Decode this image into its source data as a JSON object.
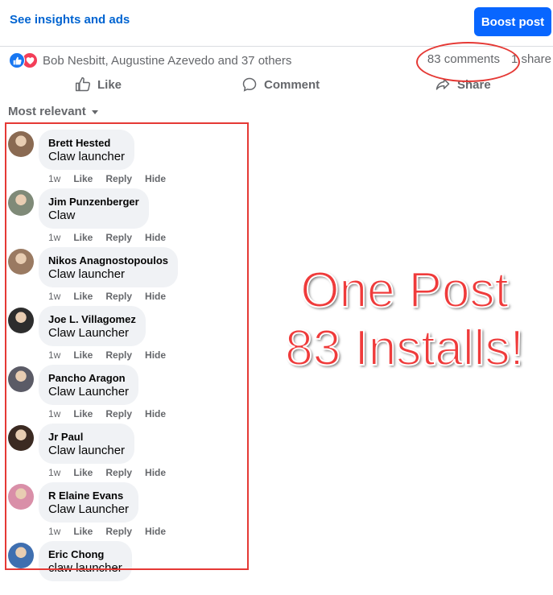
{
  "header": {
    "insights_link": "See insights and ads",
    "boost_button": "Boost post"
  },
  "reactions": {
    "icons": [
      "like-icon",
      "love-icon"
    ],
    "names": "Bob Nesbitt, Augustine Azevedo and 37 others"
  },
  "counts": {
    "comments": "83 comments",
    "shares": "1 share"
  },
  "actions": {
    "like": "Like",
    "comment": "Comment",
    "share": "Share"
  },
  "sort": {
    "label": "Most relevant"
  },
  "comments": [
    {
      "name": "Brett Hested",
      "text": "Claw launcher",
      "time": "1w",
      "like": "Like",
      "reply": "Reply",
      "hide": "Hide",
      "avatar_color": "#8a6a52"
    },
    {
      "name": "Jim Punzenberger",
      "text": "Claw",
      "time": "1w",
      "like": "Like",
      "reply": "Reply",
      "hide": "Hide",
      "avatar_color": "#7f8a78"
    },
    {
      "name": "Nikos Anagnostopoulos",
      "text": "Claw launcher",
      "time": "1w",
      "like": "Like",
      "reply": "Reply",
      "hide": "Hide",
      "avatar_color": "#9a7a62"
    },
    {
      "name": "Joe L. Villagomez",
      "text": "Claw Launcher",
      "time": "1w",
      "like": "Like",
      "reply": "Reply",
      "hide": "Hide",
      "avatar_color": "#2d2d2d"
    },
    {
      "name": "Pancho Aragon",
      "text": "Claw Launcher",
      "time": "1w",
      "like": "Like",
      "reply": "Reply",
      "hide": "Hide",
      "avatar_color": "#5b5b66"
    },
    {
      "name": "Jr Paul",
      "text": "Claw launcher",
      "time": "1w",
      "like": "Like",
      "reply": "Reply",
      "hide": "Hide",
      "avatar_color": "#3b2a22"
    },
    {
      "name": "R Elaine Evans",
      "text": "Claw Launcher",
      "time": "1w",
      "like": "Like",
      "reply": "Reply",
      "hide": "Hide",
      "avatar_color": "#d98fa8"
    },
    {
      "name": "Eric Chong",
      "text": "claw launcher",
      "time": "",
      "like": "",
      "reply": "",
      "hide": "",
      "avatar_color": "#3f6fb0"
    }
  ],
  "overlay": {
    "line1": "One Post",
    "line2": "83 Installs!"
  },
  "colors": {
    "annotation_red": "#e53935",
    "brand_blue": "#0866ff",
    "link_blue": "#0064d1"
  }
}
